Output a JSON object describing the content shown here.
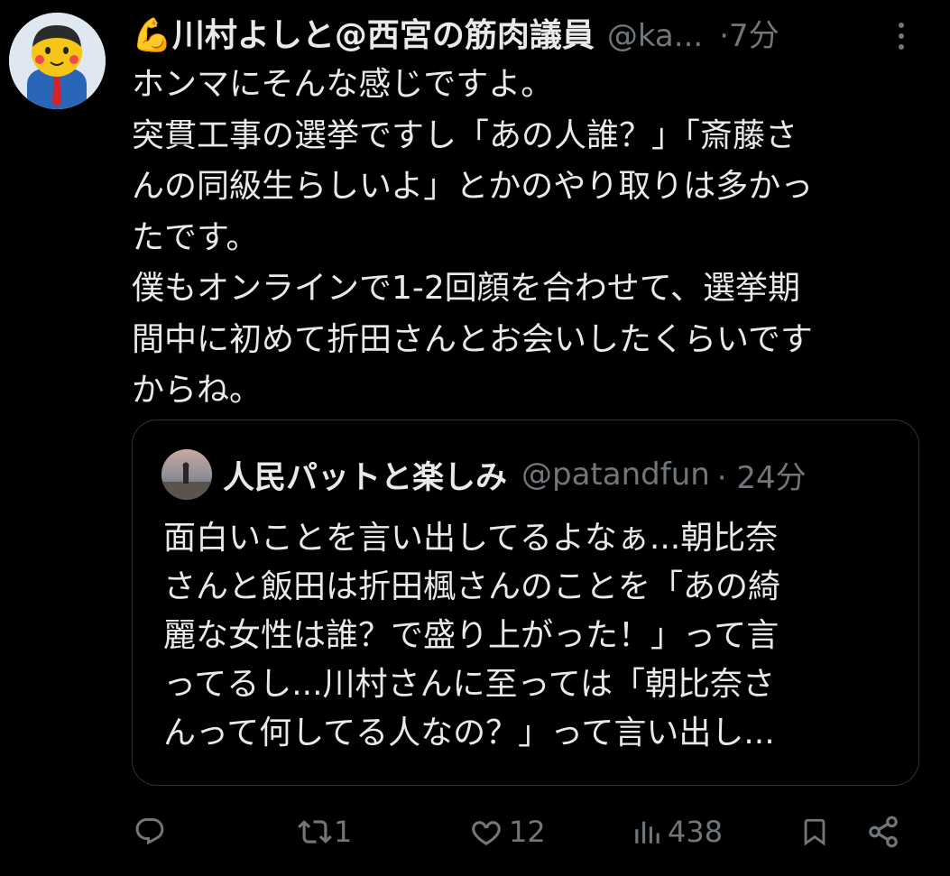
{
  "author": {
    "name": "💪川村よしと@西宮の筋肉議員",
    "handle": "@ka...",
    "time": "·7分"
  },
  "tweet": {
    "text": "ホンマにそんな感じですよ。\n突貫工事の選挙ですし「あの人誰？」「斎藤さ\nんの同級生らしいよ」とかのやり取りは多かっ\nたです。\n僕もオンラインで1-2回顔を合わせて、選挙期\n間中に初めて折田さんとお会いしたくらいです\nからね。"
  },
  "quote": {
    "name": "人民パットと楽しみ",
    "handle": "@patandfun",
    "time": "· 24分",
    "text": "面白いことを言い出してるよなぁ...朝比奈\nさんと飯田は折田楓さんのことを「あの綺\n麗な女性は誰？で盛り上がった！」って言\nってるし...川村さんに至っては「朝比奈さ\nんって何してる人なの？」って言い出し..."
  },
  "actions": {
    "reply": {
      "icon": "reply-icon",
      "count": ""
    },
    "retweet": {
      "icon": "retweet-icon",
      "count": "1"
    },
    "like": {
      "icon": "heart-icon",
      "count": "12"
    },
    "views": {
      "icon": "views-icon",
      "count": "438"
    },
    "bookmark": {
      "icon": "bookmark-icon"
    },
    "share": {
      "icon": "share-icon"
    }
  },
  "colors": {
    "background": "#000000",
    "text_primary": "#e7e9ea",
    "text_secondary": "#71767b",
    "border": "#2f3336"
  }
}
